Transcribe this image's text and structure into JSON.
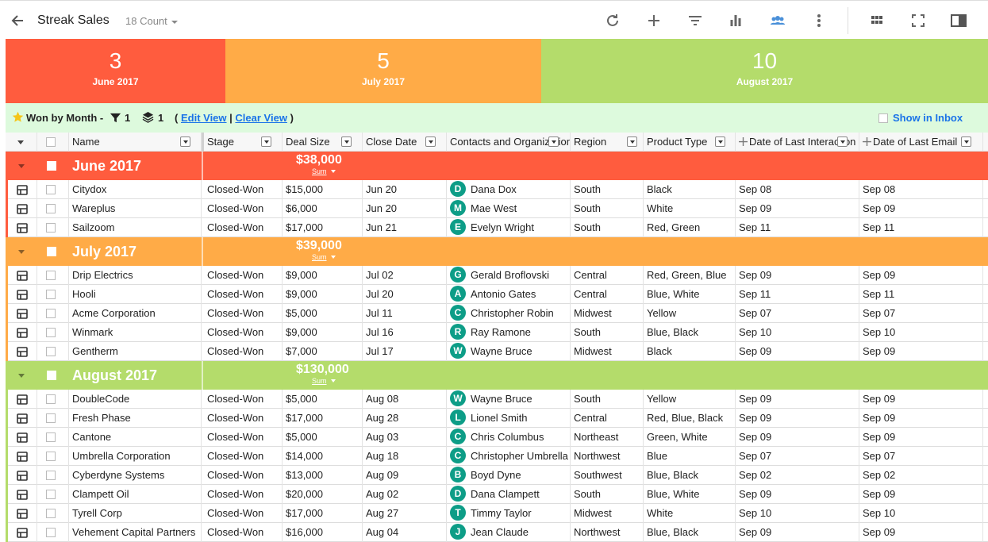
{
  "toolbar": {
    "title": "Streak Sales",
    "count": "18 Count"
  },
  "summary": [
    {
      "value": "3",
      "label": "June 2017",
      "color": "#ff5c3e"
    },
    {
      "value": "5",
      "label": "July 2017",
      "color": "#ffab47"
    },
    {
      "value": "10",
      "label": "August 2017",
      "color": "#b4dc6b"
    }
  ],
  "viewbar": {
    "view_name": "Won by Month -",
    "filter_count": "1",
    "layer_count": "1",
    "open_paren": "(",
    "edit_view": "Edit View",
    "pipe": "|",
    "clear_view": "Clear View",
    "close_paren": ")",
    "show_in_inbox": "Show in Inbox"
  },
  "columns": {
    "name": "Name",
    "stage": "Stage",
    "deal_size": "Deal Size",
    "close_date": "Close Date",
    "contacts": "Contacts and Organizations",
    "region": "Region",
    "product_type": "Product Type",
    "last_interaction": "Date of Last Interaction",
    "last_email": "Date of Last Email"
  },
  "groups": [
    {
      "name": "June 2017",
      "sum": "$38,000",
      "sum_label": "Sum",
      "color": "#ff5c3e",
      "rows": [
        {
          "name": "Citydox",
          "stage": "Closed-Won",
          "deal": "$15,000",
          "close": "Jun 20",
          "initial": "D",
          "contact": "Dana Dox",
          "region": "South",
          "product": "Black",
          "interaction": "Sep 08",
          "email": "Sep 08"
        },
        {
          "name": "Wareplus",
          "stage": "Closed-Won",
          "deal": "$6,000",
          "close": "Jun 20",
          "initial": "M",
          "contact": "Mae West",
          "region": "South",
          "product": "White",
          "interaction": "Sep 09",
          "email": "Sep 09"
        },
        {
          "name": "Sailzoom",
          "stage": "Closed-Won",
          "deal": "$17,000",
          "close": "Jun 21",
          "initial": "E",
          "contact": "Evelyn Wright",
          "region": "South",
          "product": "Red, Green",
          "interaction": "Sep 11",
          "email": "Sep 11"
        }
      ]
    },
    {
      "name": "July 2017",
      "sum": "$39,000",
      "sum_label": "Sum",
      "color": "#ffab47",
      "rows": [
        {
          "name": "Drip Electrics",
          "stage": "Closed-Won",
          "deal": "$9,000",
          "close": "Jul 02",
          "initial": "G",
          "contact": "Gerald Broflovski",
          "region": "Central",
          "product": "Red, Green, Blue",
          "interaction": "Sep 09",
          "email": "Sep 09"
        },
        {
          "name": "Hooli",
          "stage": "Closed-Won",
          "deal": "$9,000",
          "close": "Jul 20",
          "initial": "A",
          "contact": "Antonio Gates",
          "region": "Central",
          "product": "Blue, White",
          "interaction": "Sep 11",
          "email": "Sep 11"
        },
        {
          "name": "Acme Corporation",
          "stage": "Closed-Won",
          "deal": "$5,000",
          "close": "Jul 11",
          "initial": "C",
          "contact": "Christopher Robin",
          "region": "Midwest",
          "product": "Yellow",
          "interaction": "Sep 07",
          "email": "Sep 07"
        },
        {
          "name": "Winmark",
          "stage": "Closed-Won",
          "deal": "$9,000",
          "close": "Jul 16",
          "initial": "R",
          "contact": "Ray Ramone",
          "region": "South",
          "product": "Blue, Black",
          "interaction": "Sep 10",
          "email": "Sep 10"
        },
        {
          "name": "Gentherm",
          "stage": "Closed-Won",
          "deal": "$7,000",
          "close": "Jul 17",
          "initial": "W",
          "contact": "Wayne Bruce",
          "region": "Midwest",
          "product": "Black",
          "interaction": "Sep 09",
          "email": "Sep 09"
        }
      ]
    },
    {
      "name": "August 2017",
      "sum": "$130,000",
      "sum_label": "Sum",
      "color": "#b4dc6b",
      "rows": [
        {
          "name": "DoubleCode",
          "stage": "Closed-Won",
          "deal": "$5,000",
          "close": "Aug 08",
          "initial": "W",
          "contact": "Wayne Bruce",
          "region": "South",
          "product": "Yellow",
          "interaction": "Sep 09",
          "email": "Sep 09"
        },
        {
          "name": "Fresh Phase",
          "stage": "Closed-Won",
          "deal": "$17,000",
          "close": "Aug 28",
          "initial": "L",
          "contact": "Lionel Smith",
          "region": "Central",
          "product": "Red, Blue, Black",
          "interaction": "Sep 09",
          "email": "Sep 09"
        },
        {
          "name": "Cantone",
          "stage": "Closed-Won",
          "deal": "$5,000",
          "close": "Aug 03",
          "initial": "C",
          "contact": "Chris Columbus",
          "region": "Northeast",
          "product": "Green, White",
          "interaction": "Sep 09",
          "email": "Sep 09"
        },
        {
          "name": "Umbrella Corporation",
          "stage": "Closed-Won",
          "deal": "$14,000",
          "close": "Aug 18",
          "initial": "C",
          "contact": "Christopher Umbrella",
          "region": "Northwest",
          "product": "Blue",
          "interaction": "Sep 07",
          "email": "Sep 07"
        },
        {
          "name": "Cyberdyne Systems",
          "stage": "Closed-Won",
          "deal": "$13,000",
          "close": "Aug 09",
          "initial": "B",
          "contact": "Boyd Dyne",
          "region": "Southwest",
          "product": "Blue, Black",
          "interaction": "Sep 02",
          "email": "Sep 02"
        },
        {
          "name": "Clampett Oil",
          "stage": "Closed-Won",
          "deal": "$20,000",
          "close": "Aug 02",
          "initial": "D",
          "contact": "Dana Clampett",
          "region": "South",
          "product": "Blue, White",
          "interaction": "Sep 09",
          "email": "Sep 09"
        },
        {
          "name": "Tyrell Corp",
          "stage": "Closed-Won",
          "deal": "$17,000",
          "close": "Aug 27",
          "initial": "T",
          "contact": "Timmy Taylor",
          "region": "Midwest",
          "product": "White",
          "interaction": "Sep 10",
          "email": "Sep 10"
        },
        {
          "name": "Vehement Capital Partners",
          "stage": "Closed-Won",
          "deal": "$16,000",
          "close": "Aug 04",
          "initial": "J",
          "contact": "Jean Claude",
          "region": "Northwest",
          "product": "Blue, Black",
          "interaction": "Sep 09",
          "email": "Sep 09"
        }
      ]
    }
  ]
}
